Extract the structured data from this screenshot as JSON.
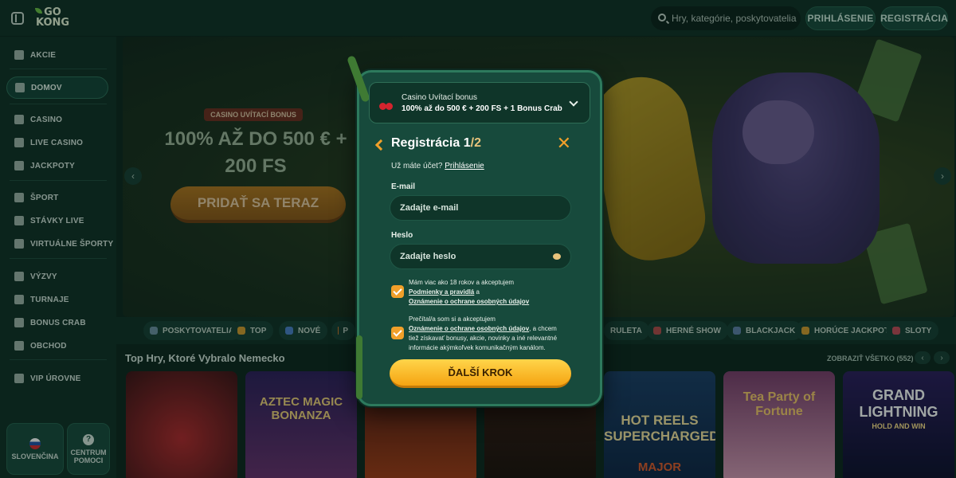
{
  "header": {
    "logo_text_1": "GO",
    "logo_text_2": "KONG",
    "search_placeholder": "Hry, kategórie, poskytovatelia",
    "login_label": "PRIHLÁSENIE",
    "register_label": "REGISTRÁCIA"
  },
  "sidebar": {
    "items": [
      {
        "label": "AKCIE",
        "icon": "gift-icon"
      },
      {
        "label": "DOMOV",
        "icon": "home-icon"
      },
      {
        "label": "CASINO",
        "icon": "slot-icon"
      },
      {
        "label": "LIVE CASINO",
        "icon": "phone-icon"
      },
      {
        "label": "JACKPOTY",
        "icon": "clover-icon"
      },
      {
        "label": "ŠPORT",
        "icon": "ball-icon"
      },
      {
        "label": "STÁVKY LIVE",
        "icon": "tv-icon"
      },
      {
        "label": "VIRTUÁLNE ŠPORTY",
        "icon": "monitor-icon"
      },
      {
        "label": "VÝZVY",
        "icon": "medal-icon"
      },
      {
        "label": "TURNAJE",
        "icon": "trophy-icon"
      },
      {
        "label": "BONUS CRAB",
        "icon": "crab-icon"
      },
      {
        "label": "OBCHOD",
        "icon": "bag-icon"
      },
      {
        "label": "VIP ÚROVNE",
        "icon": "diamond-icon"
      }
    ],
    "language_label": "SLOVENČINA",
    "help_label_1": "CENTRUM",
    "help_label_2": "POMOCI"
  },
  "hero": {
    "badge": "CASINO UVÍTACÍ BONUS",
    "title": "100% AŽ DO 500 € + 200 FS",
    "cta": "PRIDAŤ SA TERAZ"
  },
  "categories": [
    "POSKYTOVATELIA",
    "TOP",
    "NOVÉ",
    "P",
    "RULETA",
    "HERNÉ SHOW",
    "BLACKJACK",
    "HORÚCE JACKPOTY",
    "SLOTY"
  ],
  "games_section": {
    "title": "Top Hry, Ktoré Vybralo Nemecko",
    "view_all": "ZOBRAZIŤ VŠETKO (552)",
    "tiles": [
      {
        "title": ""
      },
      {
        "title": "AZTEC MAGIC BONANZA"
      },
      {
        "title": ""
      },
      {
        "title": ""
      },
      {
        "title": "HOT REELS SUPERCHARGED",
        "sub": "MAJOR"
      },
      {
        "title": "Tea Party of Fortune"
      },
      {
        "title": "GRAND LIGHTNING",
        "sub": "HOLD AND WIN"
      }
    ]
  },
  "modal": {
    "bonus_label": "Casino Uvítací bonus",
    "bonus_desc": "100% až do 500 € + 200 FS + 1 Bonus Crab",
    "title": "Registrácia",
    "step": "1",
    "step_total": "/2",
    "have_account": "Už máte účet?",
    "login_link": "Prihlásenie",
    "email_label": "E-mail",
    "email_placeholder": "Zadajte e-mail",
    "password_label": "Heslo",
    "password_placeholder": "Zadajte heslo",
    "consent1_line1": "Mám viac ako 18 rokov a akceptujem",
    "consent1_link1": "Podmienky a pravidlá",
    "consent1_and": " a",
    "consent1_link2": "Oznámenie o ochrane osobných údajov",
    "consent2_line1": "Prečítal/a som si a akceptujem",
    "consent2_link": "Oznámenie o ochrane osobných údajov",
    "consent2_rest": ", a chcem tiež získavať bonusy, akcie, novinky a iné relevantné informácie akýmkoľvek komunikačným kanálom.",
    "next_label": "ĎALŠÍ KROK"
  },
  "colors": {
    "accent_orange": "#f1a02a",
    "cta_yellow": "#ffd54a",
    "modal_bg": "#174a3c",
    "page_bg": "#0f2e25"
  }
}
